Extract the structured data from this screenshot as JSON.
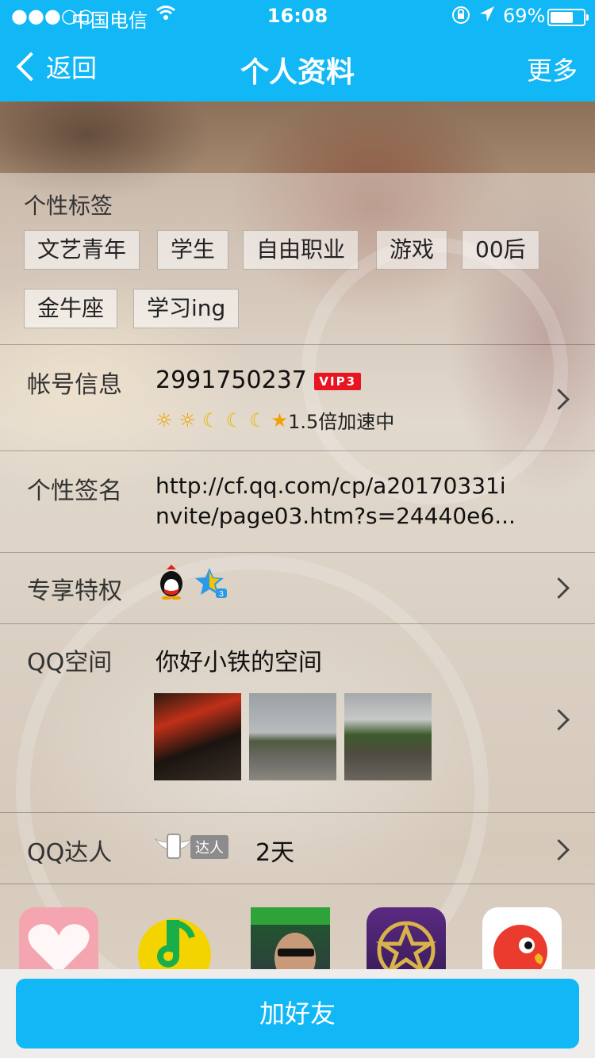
{
  "status": {
    "signal": "●●●○○",
    "carrier": "中国电信",
    "time": "16:08",
    "battery": "69%",
    "battery_level": 0.69
  },
  "nav": {
    "back_label": "返回",
    "title": "个人资料",
    "more_label": "更多"
  },
  "tags": {
    "title": "个性标签",
    "items": [
      "文艺青年",
      "学生",
      "自由职业",
      "游戏",
      "00后",
      "金牛座",
      "学习ing"
    ]
  },
  "account": {
    "label": "帐号信息",
    "qq_number": "2991750237",
    "vip_badge": "VIP3",
    "level_icons": [
      "sun-icon",
      "sun-icon",
      "moon-icon",
      "moon-icon",
      "moon-icon",
      "star-icon"
    ],
    "speed_text": "1.5倍加速中"
  },
  "signature": {
    "label": "个性签名",
    "line1": "http://cf.qq.com/cp/a20170331i",
    "line2": "nvite/page03.htm?s=24440e6..."
  },
  "privilege": {
    "label": "专享特权",
    "icons": [
      "qq-penguin-icon",
      "star-badge-icon"
    ]
  },
  "qzone": {
    "label": "QQ空间",
    "title": "你好小铁的空间",
    "photos": [
      "game-screenshot-photo",
      "road-photo",
      "puddle-photo"
    ]
  },
  "daren": {
    "label": "QQ达人",
    "badge": "达人",
    "days": "2天"
  },
  "apps": [
    "heart-app-icon",
    "qq-music-icon",
    "game-app-icon",
    "star-app-icon",
    "parrot-app-icon"
  ],
  "bottom": {
    "add_friend": "加好友"
  },
  "colors": {
    "accent": "#12b7f5",
    "vip_red": "#e8141f"
  }
}
